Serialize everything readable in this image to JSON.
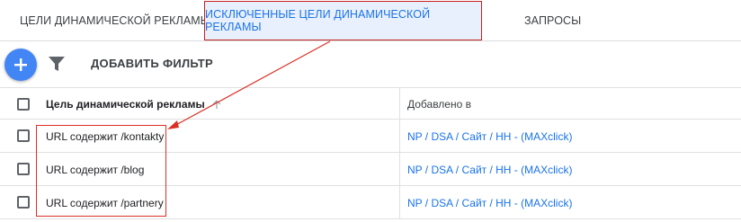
{
  "tabs": [
    {
      "label": "ЦЕЛИ ДИНАМИЧЕСКОЙ РЕКЛАМЫ",
      "active": false
    },
    {
      "label": "ИСКЛЮЧЕННЫЕ ЦЕЛИ ДИНАМИЧЕСКОЙ РЕКЛАМЫ",
      "active": true
    },
    {
      "label": "ЗАПРОСЫ",
      "active": false
    }
  ],
  "toolbar": {
    "add_icon": "plus-icon",
    "filter_icon": "filter-icon",
    "add_filter_label": "ДОБАВИТЬ ФИЛЬТР"
  },
  "table": {
    "headers": {
      "target": "Цель динамической рекламы",
      "added_to": "Добавлено в",
      "sort_icon": "arrow-up-icon"
    },
    "rows": [
      {
        "target": "URL содержит /kontakty",
        "added_to": "NP / DSA / Сайт / НН - (MAXclick)"
      },
      {
        "target": "URL содержит /blog",
        "added_to": "NP / DSA / Сайт / НН - (MAXclick)"
      },
      {
        "target": "URL содержит /partnery",
        "added_to": "NP / DSA / Сайт / НН - (MAXclick)"
      }
    ]
  },
  "colors": {
    "accent": "#1a73e8",
    "fab": "#4285f4",
    "active_tab_bg": "#e8f0fe",
    "annotation": "#d93025"
  }
}
